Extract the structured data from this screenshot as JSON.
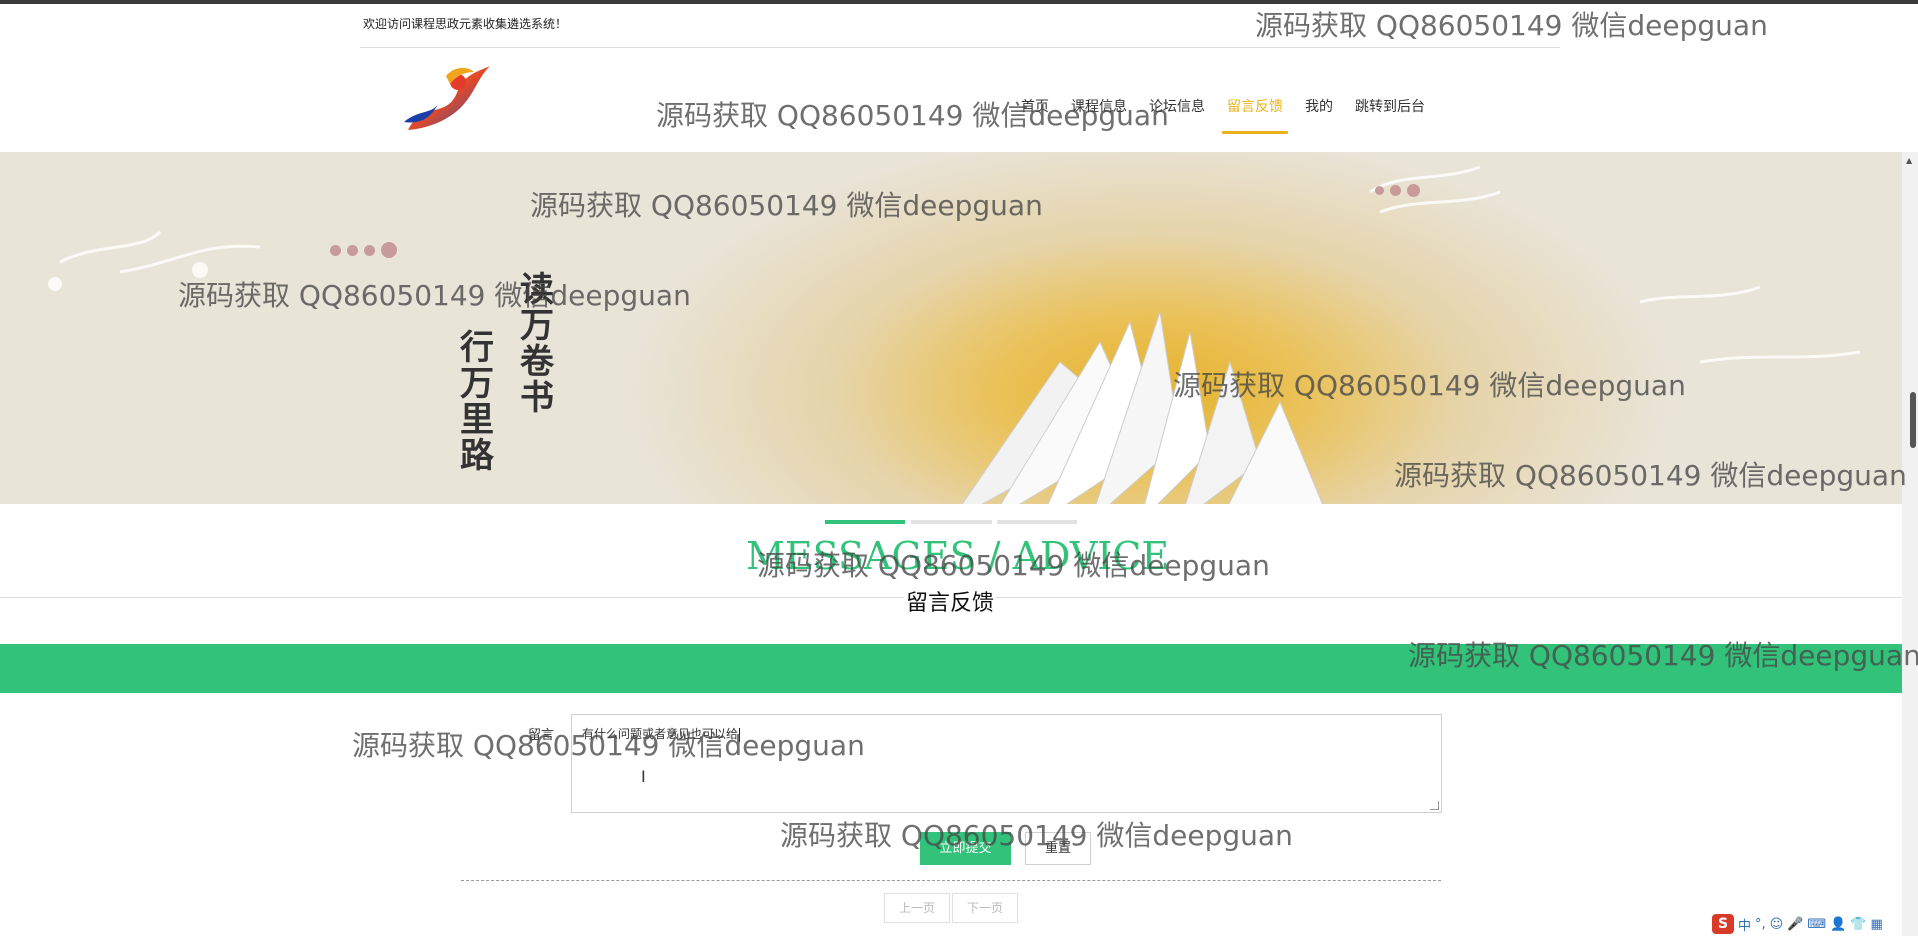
{
  "header": {
    "welcome_text": "欢迎访问课程思政元素收集遴选系统！",
    "logo_icon": "phoenix-logo-icon",
    "nav": [
      {
        "label": "首页",
        "active": false
      },
      {
        "label": "课程信息",
        "active": false
      },
      {
        "label": "论坛信息",
        "active": false
      },
      {
        "label": "留言反馈",
        "active": true
      },
      {
        "label": "我的",
        "active": false
      },
      {
        "label": "跳转到后台",
        "active": false
      }
    ]
  },
  "banner": {
    "poem_col1": "读万卷书",
    "poem_col2": "行万里路",
    "carousel_active_index": 0,
    "carousel_count": 3
  },
  "section": {
    "title_en": "MESSAGES / ADVICE",
    "title_cn": "留言反馈"
  },
  "form": {
    "label": "留言",
    "value": "有什么问题或者意见也可以给"
  },
  "buttons": {
    "submit": "立即提交",
    "reset": "重置"
  },
  "pager": {
    "prev": "上一页",
    "next": "下一页"
  },
  "ime": {
    "logo": "S",
    "mode": "中",
    "punct": "°,"
  },
  "watermark": "源码获取 QQ86050149 微信deepguan",
  "colors": {
    "accent_green": "#32c27a",
    "nav_active": "#e9b21a"
  }
}
